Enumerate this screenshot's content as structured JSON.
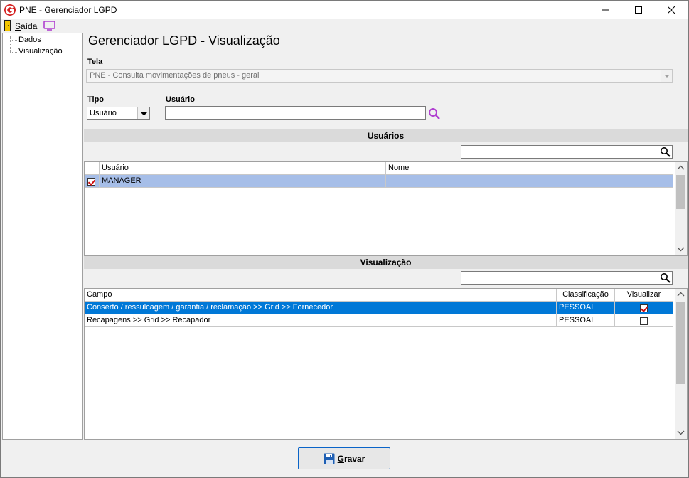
{
  "window": {
    "title": "PNE - Gerenciador LGPD"
  },
  "toolbar": {
    "exit_label": "Saída",
    "exit_mnemonic": "S",
    "exit_rest": "aída"
  },
  "tree": {
    "items": [
      "Dados",
      "Visualização"
    ]
  },
  "main": {
    "title": "Gerenciador LGPD - Visualização",
    "tela_label": "Tela",
    "tela_value": "PNE - Consulta movimentações de pneus - geral",
    "tipo_label": "Tipo",
    "tipo_value": "Usuário",
    "usuario_label": "Usuário",
    "usuario_value": ""
  },
  "usuarios": {
    "header": "Usuários",
    "filter_value": "",
    "columns": [
      "Usuário",
      "Nome"
    ],
    "rows": [
      {
        "checked": true,
        "usuario": "MANAGER",
        "nome": ""
      }
    ]
  },
  "visualizacao": {
    "header": "Visualização",
    "filter_value": "",
    "columns": [
      "Campo",
      "Classificação",
      "Visualizar"
    ],
    "rows": [
      {
        "campo": "Conserto / ressulcagem / garantia / reclamação >> Grid >> Fornecedor",
        "classificacao": "PESSOAL",
        "visualizar": true
      },
      {
        "campo": "Recapagens >> Grid >> Recapador",
        "classificacao": "PESSOAL",
        "visualizar": false
      }
    ]
  },
  "footer": {
    "save_label": "Gravar",
    "save_mnemonic": "G",
    "save_rest": "ravar"
  },
  "colors": {
    "selected_row_primary": "#0078d7",
    "selected_row_secondary": "#a6bee8",
    "section_header": "#dadada",
    "accent_purple": "#b040d0"
  }
}
